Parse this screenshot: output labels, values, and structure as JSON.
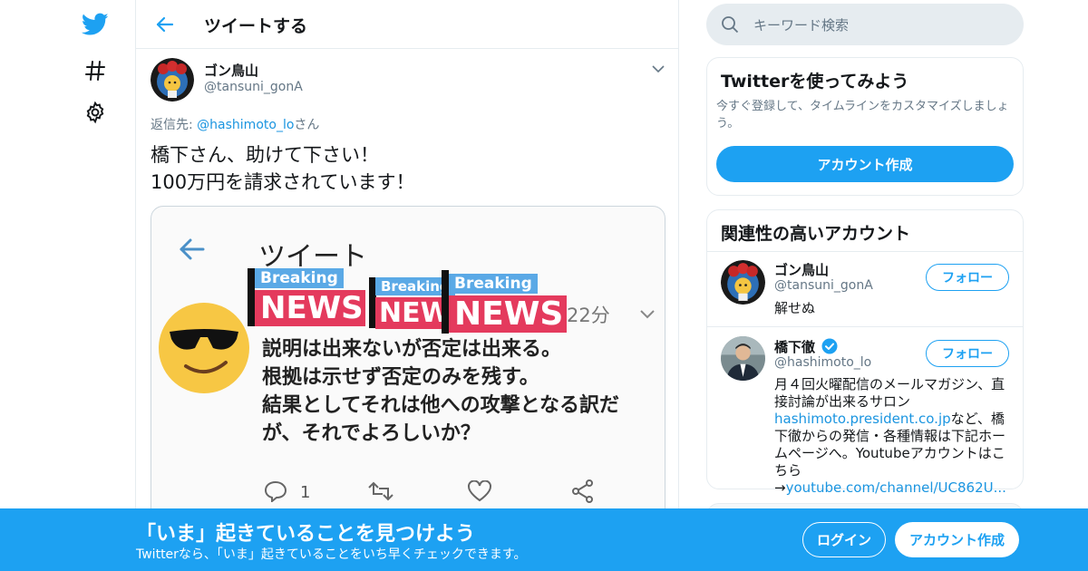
{
  "nav": {
    "icons": [
      "twitter-logo-icon",
      "hashtag-icon",
      "gear-icon"
    ],
    "accent": "#1da1f2"
  },
  "header": {
    "title": "ツイートする"
  },
  "tweet": {
    "author_name": "ゴン鳥山",
    "author_handle": "@tansuni_gonA",
    "reply_prefix": "返信先: ",
    "reply_handle": "@hashimoto_lo",
    "reply_suffix": "さん",
    "text": "橋下さん、助けて下さい！\n100万円を請求されています！"
  },
  "media": {
    "title": "ツイート",
    "time": "22分",
    "body": "説明は出来ないが否定は出来る。\n根拠は示せず否定のみを残す。\n結果としてそれは他への攻撃となる訳だ\nが、それでよろしいか？",
    "reply_count": "1",
    "breaking_label": "Breaking",
    "news_label": "NEWS",
    "news_label_cut": "NEW"
  },
  "search": {
    "placeholder": "キーワード検索"
  },
  "signup_card": {
    "title": "Twitterを使ってみよう",
    "description": "今すぐ登録して、タイムラインをカスタマイズしましょう。",
    "button": "アカウント作成"
  },
  "related": {
    "title": "関連性の高いアカウント",
    "accounts": [
      {
        "name": "ゴン鳥山",
        "handle": "@tansuni_gonA",
        "bio": "解せぬ",
        "follow": "フォロー"
      },
      {
        "name": "橋下徹",
        "handle": "@hashimoto_lo",
        "bio_1": "月４回火曜配信のメールマガジン、直接討論が出来るサロン",
        "bio_link1": "hashimoto.president.co.jp",
        "bio_2": "など、橋下徹からの発信・各種情報は下記ホームページへ。Youtubeアカウントはこちら→",
        "bio_link2": "youtube.com/channel/UC862U...",
        "follow": "フォロー",
        "verified": true
      }
    ]
  },
  "banner": {
    "title": "「いま」起きていることを見つけよう",
    "subtitle": "Twitterなら、「いま」起きていることをいち早くチェックできます。",
    "login": "ログイン",
    "signup": "アカウント作成"
  }
}
